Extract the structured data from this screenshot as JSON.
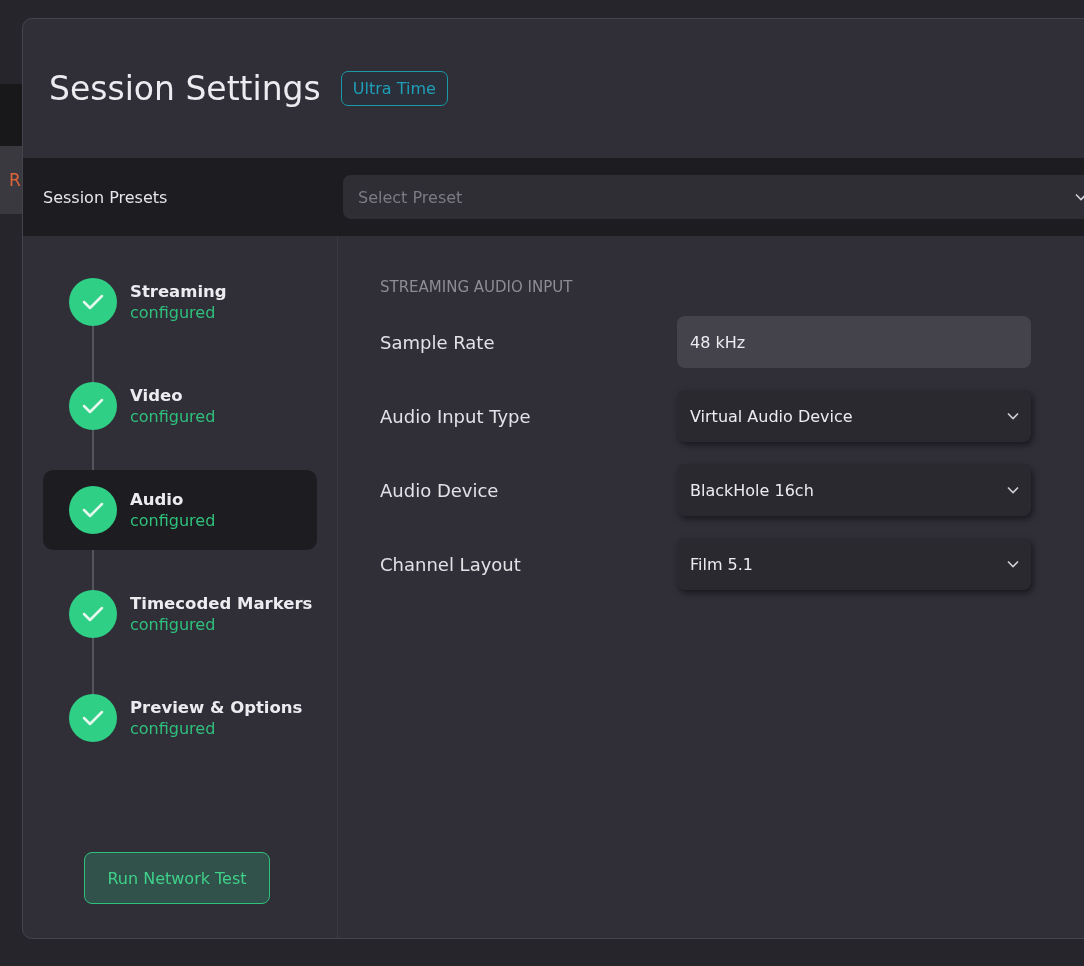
{
  "background_window": {
    "text": "R"
  },
  "dialog": {
    "title": "Session Settings",
    "badge": "Ultra Time"
  },
  "presets": {
    "label": "Session Presets",
    "placeholder": "Select Preset"
  },
  "steps": [
    {
      "title": "Streaming",
      "status": "configured",
      "selected": false,
      "done": true
    },
    {
      "title": "Video",
      "status": "configured",
      "selected": false,
      "done": true
    },
    {
      "title": "Audio",
      "status": "configured",
      "selected": true,
      "done": true
    },
    {
      "title": "Timecoded Markers",
      "status": "configured",
      "selected": false,
      "done": true
    },
    {
      "title": "Preview & Options",
      "status": "configured",
      "selected": false,
      "done": true
    }
  ],
  "network_test_button": "Run Network Test",
  "section": {
    "heading": "STREAMING AUDIO INPUT",
    "fields": [
      {
        "label": "Sample Rate",
        "value": "48 kHz",
        "kind": "static"
      },
      {
        "label": "Audio Input Type",
        "value": "Virtual Audio Device",
        "kind": "select"
      },
      {
        "label": "Audio Device",
        "value": "BlackHole 16ch",
        "kind": "select"
      },
      {
        "label": "Channel Layout",
        "value": "Film 5.1",
        "kind": "select"
      }
    ]
  }
}
